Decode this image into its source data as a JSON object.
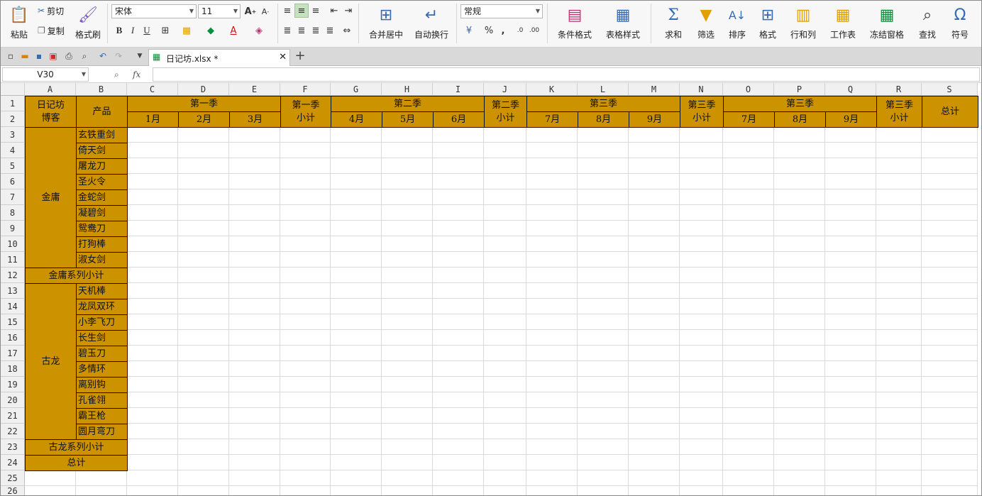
{
  "ribbon": {
    "paste": "粘贴",
    "cut": "剪切",
    "copy": "复制",
    "format_painter": "格式刷",
    "font_name": "宋体",
    "font_size": "11",
    "merge_center": "合并居中",
    "wrap_text": "自动换行",
    "number_format": "常规",
    "cond_format": "条件格式",
    "table_style": "表格样式",
    "sum": "求和",
    "filter": "筛选",
    "sort": "排序",
    "format": "格式",
    "rows_cols": "行和列",
    "worksheet": "工作表",
    "freeze": "冻结窗格",
    "find": "查找",
    "symbol": "符号"
  },
  "tabs": {
    "file": "日记坊.xlsx *"
  },
  "formula": {
    "name_box": "V30",
    "fx": "fx",
    "value": ""
  },
  "columns": [
    "A",
    "B",
    "C",
    "D",
    "E",
    "F",
    "G",
    "H",
    "I",
    "J",
    "K",
    "L",
    "M",
    "N",
    "O",
    "P",
    "Q",
    "R",
    "S"
  ],
  "rows": [
    "1",
    "2",
    "3",
    "4",
    "5",
    "6",
    "7",
    "8",
    "9",
    "10",
    "11",
    "12",
    "13",
    "14",
    "15",
    "16",
    "17",
    "18",
    "19",
    "20",
    "21",
    "22",
    "23",
    "24",
    "25",
    "26"
  ],
  "sheet": {
    "a12": "日记坊\n博客",
    "b12": "产品",
    "q1": "第一季",
    "q2": "第二季",
    "q3a": "第三季",
    "q3b": "第三季",
    "f12": "第一季\n小计",
    "j12": "第二季\n小计",
    "n12": "第三季\n小计",
    "r12": "第三季\n小计",
    "s12": "总计",
    "months": [
      "1月",
      "2月",
      "3月",
      "4月",
      "5月",
      "6月",
      "7月",
      "8月",
      "9月",
      "7月",
      "8月",
      "9月"
    ],
    "group1": "金庸",
    "group2": "古龙",
    "products1": [
      "玄铁重剑",
      "倚天剑",
      "屠龙刀",
      "圣火令",
      "金蛇剑",
      "凝碧剑",
      "鸳鸯刀",
      "打狗棒",
      "淑女剑"
    ],
    "products2": [
      "天机棒",
      "龙凤双环",
      "小李飞刀",
      "长生剑",
      "碧玉刀",
      "多情环",
      "离别钩",
      "孔雀翎",
      "霸王枪",
      "圆月弯刀"
    ],
    "subtotal1": "金庸系列小计",
    "subtotal2": "古龙系列小计",
    "total": "总计"
  },
  "colors": {
    "header_fill": "#cc9200",
    "selected_tool": "#c5e1c0"
  }
}
